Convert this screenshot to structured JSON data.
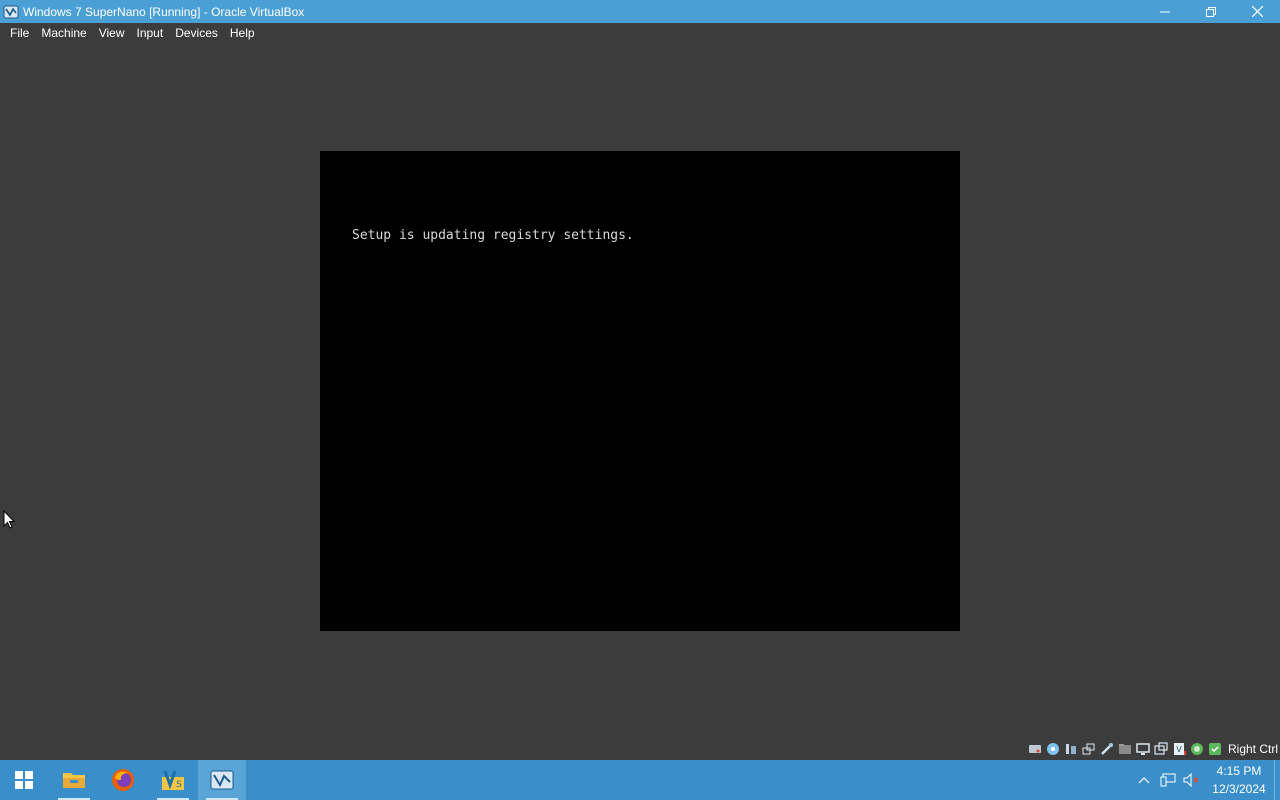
{
  "window": {
    "title": "Windows 7 SuperNano [Running] - Oracle VirtualBox",
    "app_icon": "virtualbox-icon",
    "controls": [
      "minimize-icon",
      "restore-icon",
      "close-icon"
    ]
  },
  "menubar": {
    "items": [
      {
        "label": "File"
      },
      {
        "label": "Machine"
      },
      {
        "label": "View"
      },
      {
        "label": "Input"
      },
      {
        "label": "Devices"
      },
      {
        "label": "Help"
      }
    ]
  },
  "vm": {
    "message": "Setup is updating registry settings."
  },
  "statusbar": {
    "icons": [
      "hard-disk-icon",
      "optical-drive-icon",
      "audio-icon",
      "network-icon",
      "usb-icon",
      "shared-folders-icon",
      "display-icon",
      "video-capture-icon",
      "virtualization-icon",
      "mouse-integration-icon",
      "keyboard-icon"
    ],
    "host_key": "Right Ctrl"
  },
  "taskbar": {
    "apps": [
      {
        "name": "start-button",
        "icon": "windows-logo-icon"
      },
      {
        "name": "file-explorer",
        "icon": "folder-icon"
      },
      {
        "name": "firefox",
        "icon": "firefox-icon"
      },
      {
        "name": "visual-studio",
        "icon": "vs-icon"
      },
      {
        "name": "virtualbox",
        "icon": "virtualbox-icon",
        "active": true
      }
    ],
    "tray": {
      "icons": [
        "show-hidden-icons-chevron",
        "network-icon",
        "volume-muted-icon"
      ],
      "time": "4:15 PM",
      "date": "12/3/2024"
    }
  },
  "colors": {
    "titlebar": "#4a9fd5",
    "background": "#3c3c3c",
    "taskbar": "#3a8fcb",
    "vm_screen": "#000000"
  }
}
